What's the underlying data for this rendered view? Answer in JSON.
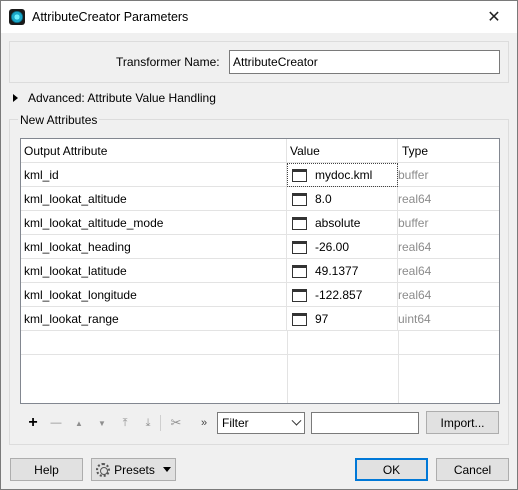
{
  "window": {
    "title": "AttributeCreator Parameters"
  },
  "transformer": {
    "label": "Transformer Name:",
    "value": "AttributeCreator"
  },
  "advanced": {
    "label": "Advanced: Attribute Value Handling"
  },
  "new_attributes": {
    "label": "New Attributes",
    "columns": [
      "Output Attribute",
      "Value",
      "Type"
    ],
    "rows": [
      {
        "attribute": "kml_id",
        "value": "mydoc.kml",
        "type": "buffer"
      },
      {
        "attribute": "kml_lookat_altitude",
        "value": "8.0",
        "type": "real64"
      },
      {
        "attribute": "kml_lookat_altitude_mode",
        "value": "absolute",
        "type": "buffer"
      },
      {
        "attribute": "kml_lookat_heading",
        "value": "-26.00",
        "type": "real64"
      },
      {
        "attribute": "kml_lookat_latitude",
        "value": "49.1377",
        "type": "real64"
      },
      {
        "attribute": "kml_lookat_longitude",
        "value": "-122.857",
        "type": "real64"
      },
      {
        "attribute": "kml_lookat_range",
        "value": "97",
        "type": "uint64"
      }
    ]
  },
  "toolbar": {
    "add": "+",
    "remove": "—",
    "move_up": "▲",
    "move_down": "▼",
    "move_top": "⤒",
    "move_bottom": "⤓",
    "cut": "✂",
    "more": "»"
  },
  "filter": {
    "selected": "Filter",
    "text": ""
  },
  "buttons": {
    "import": "Import...",
    "help": "Help",
    "presets": "Presets",
    "ok": "OK",
    "cancel": "Cancel"
  }
}
